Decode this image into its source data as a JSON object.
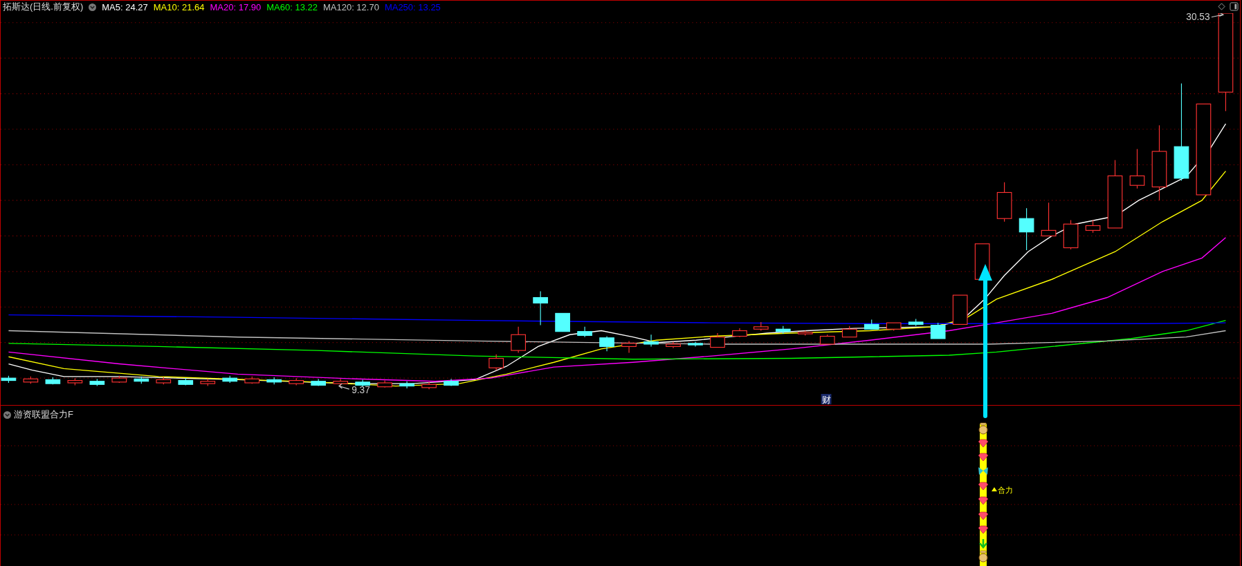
{
  "chart": {
    "title": "拓斯达(日线.前复权)",
    "ma_legend": [
      {
        "label": "MA5: 24.27",
        "color": "#ffffff"
      },
      {
        "label": "MA10: 21.64",
        "color": "#ffff00"
      },
      {
        "label": "MA20: 17.90",
        "color": "#ff00ff"
      },
      {
        "label": "MA60: 13.22",
        "color": "#00ff00"
      },
      {
        "label": "MA120: 12.70",
        "color": "#c0c0c0"
      },
      {
        "label": "MA250: 13.25",
        "color": "#0000ff"
      }
    ],
    "high_label": "30.53",
    "low_label": "9.37",
    "event_badge": "财"
  },
  "indicator": {
    "title": "游资联盟合力F",
    "signal_label": "合力"
  }
}
